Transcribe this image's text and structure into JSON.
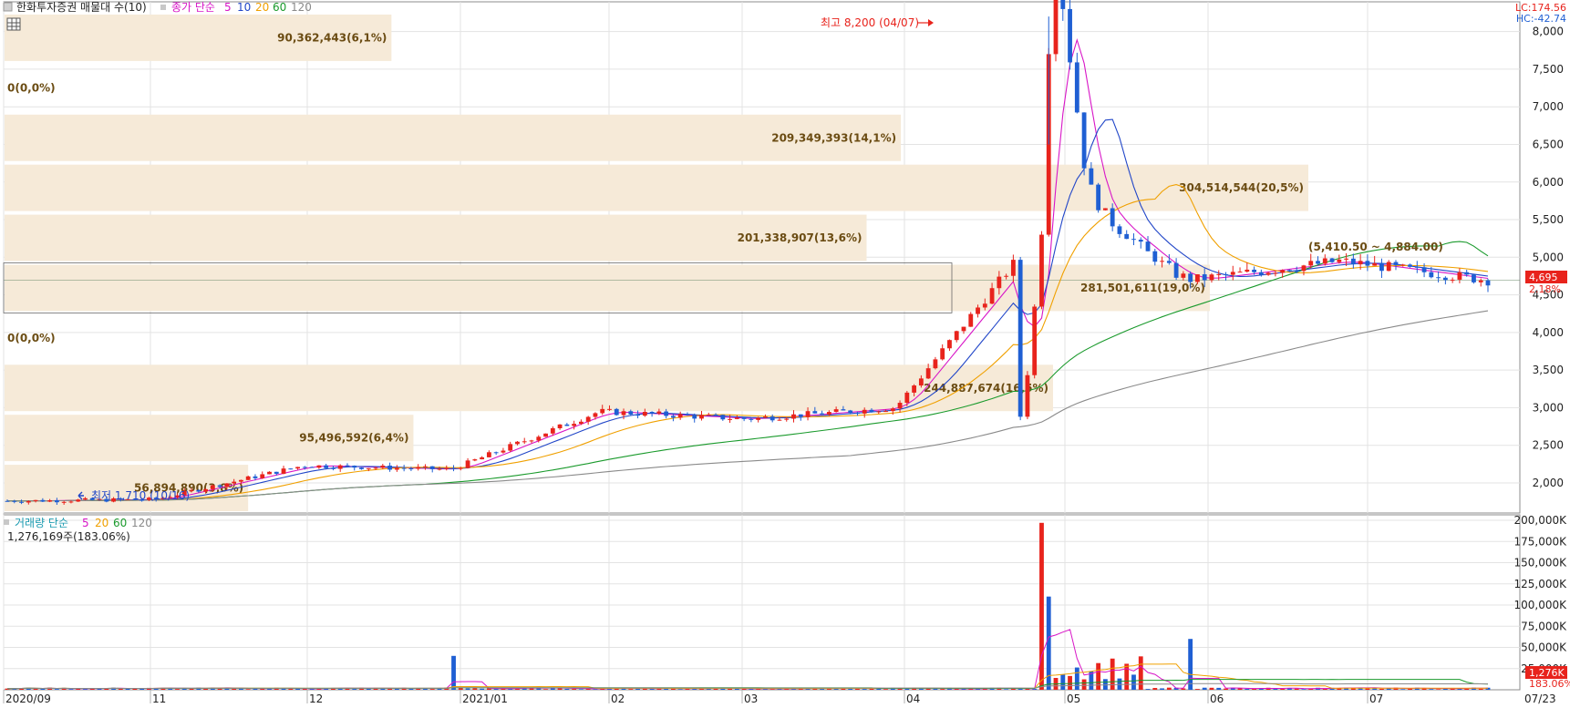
{
  "header": {
    "price_title": "한화투자증권 매물대 수(10)",
    "price_ma_prefix": "종가 단순",
    "price_ma_periods": [
      "5",
      "10",
      "20",
      "60",
      "120"
    ],
    "volume_title": "거래량 단순",
    "volume_ma_periods": [
      "5",
      "20",
      "60",
      "120"
    ],
    "volume_current": "1,276,169주(183.06%)",
    "lc_label": "LC:174.56",
    "hc_label": "HC:-42.74"
  },
  "colors": {
    "up": "#e8231c",
    "down": "#1f5fd3",
    "ma5": "#d815c7",
    "ma10": "#2146c8",
    "ma20": "#f0a000",
    "ma60": "#1a9a2c",
    "ma120": "#8a8a8a",
    "volume_profile": "#f6ead8",
    "volume_profile_text": "#6b4c13",
    "grid": "#e3e3e3"
  },
  "annotations": {
    "high": "최고 8,200 (04/07)",
    "low": "최저 1,710 (10/16)",
    "current_price": "4,695",
    "current_change": "2.18%",
    "current_volume": "1,276K",
    "current_volume_pct": "183.06%",
    "price_zone": "(5,410.50 ~ 4,884.00)"
  },
  "chart_data": [
    {
      "type": "candlestick",
      "title": "한화투자증권 매물대 수(10)",
      "x_labels": [
        "2020/09",
        "11",
        "12",
        "2021/01",
        "02",
        "03",
        "04",
        "05",
        "06",
        "07",
        "07/23"
      ],
      "y_ticks": [
        "2,000",
        "2,500",
        "3,000",
        "3,500",
        "4,000",
        "4,500",
        "5,000",
        "5,500",
        "6,000",
        "6,500",
        "7,000",
        "7,500",
        "8,000"
      ],
      "ylim": [
        1600,
        8250
      ],
      "moving_averages": [
        "5",
        "10",
        "20",
        "60",
        "120"
      ],
      "volume_profile": [
        {
          "range": [
            1600,
            2265
          ],
          "label": "56,894,890(3,8%)",
          "align": "left"
        },
        {
          "range": [
            2265,
            2930
          ],
          "label": "95,496,592(6,4%)",
          "align": "left"
        },
        {
          "range": [
            2930,
            3595
          ],
          "label": "244,887,674(16,5%)",
          "align": "mid"
        },
        {
          "range": [
            3595,
            4260
          ],
          "label": "0(0,0%)",
          "align": "none"
        },
        {
          "range": [
            4260,
            4925
          ],
          "label": "281,501,611(19,0%)",
          "align": "mid"
        },
        {
          "range": [
            4925,
            5590
          ],
          "label": "201,338,907(13,6%)",
          "align": "mid"
        },
        {
          "range": [
            5590,
            6255
          ],
          "label": "304,514,544(20,5%)",
          "align": "mid"
        },
        {
          "range": [
            6255,
            6920
          ],
          "label": "209,349,393(14,1%)",
          "align": "mid"
        },
        {
          "range": [
            6920,
            7585
          ],
          "label": "0(0,0%)",
          "align": "none"
        },
        {
          "range": [
            7585,
            8250
          ],
          "label": "90,362,443(6,1%)",
          "align": "small"
        }
      ],
      "monthly_price_path": [
        {
          "month": "2020/09",
          "open": 1730,
          "close": 1760
        },
        {
          "month": "10",
          "open": 1760,
          "close": 1780
        },
        {
          "month": "11",
          "open": 1780,
          "close": 2230
        },
        {
          "month": "12",
          "open": 2230,
          "close": 2180
        },
        {
          "month": "2021/01",
          "open": 2180,
          "close": 2950
        },
        {
          "month": "02",
          "open": 2950,
          "close": 2850
        },
        {
          "month": "03",
          "open": 2850,
          "close": 3000
        },
        {
          "month": "04",
          "open": 3000,
          "close": 5400
        },
        {
          "month": "05",
          "open": 5400,
          "close": 4700
        },
        {
          "month": "06",
          "open": 4700,
          "close": 4950
        },
        {
          "month": "07",
          "open": 4950,
          "close": 4695
        }
      ],
      "high": {
        "value": 8200,
        "date": "04/07"
      },
      "low": {
        "value": 1710,
        "date": "10/16"
      },
      "last": {
        "value": 4695,
        "change_pct": 2.18
      }
    },
    {
      "type": "bar",
      "title": "거래량",
      "y_ticks": [
        "25,000K",
        "50,000K",
        "75,000K",
        "100,000K",
        "125,000K",
        "150,000K",
        "175,000K",
        "200,000K"
      ],
      "ylim": [
        0,
        200000
      ],
      "unit": "K",
      "peak_volumes": [
        {
          "date": "2021/01 first week",
          "value": 40000
        },
        {
          "date": "04 first week",
          "value": 197000
        },
        {
          "date": "04 first week next",
          "value": 110000
        },
        {
          "date": "06 first week",
          "value": 60000
        }
      ],
      "last": {
        "value": 1276,
        "change_pct": 183.06
      }
    }
  ]
}
